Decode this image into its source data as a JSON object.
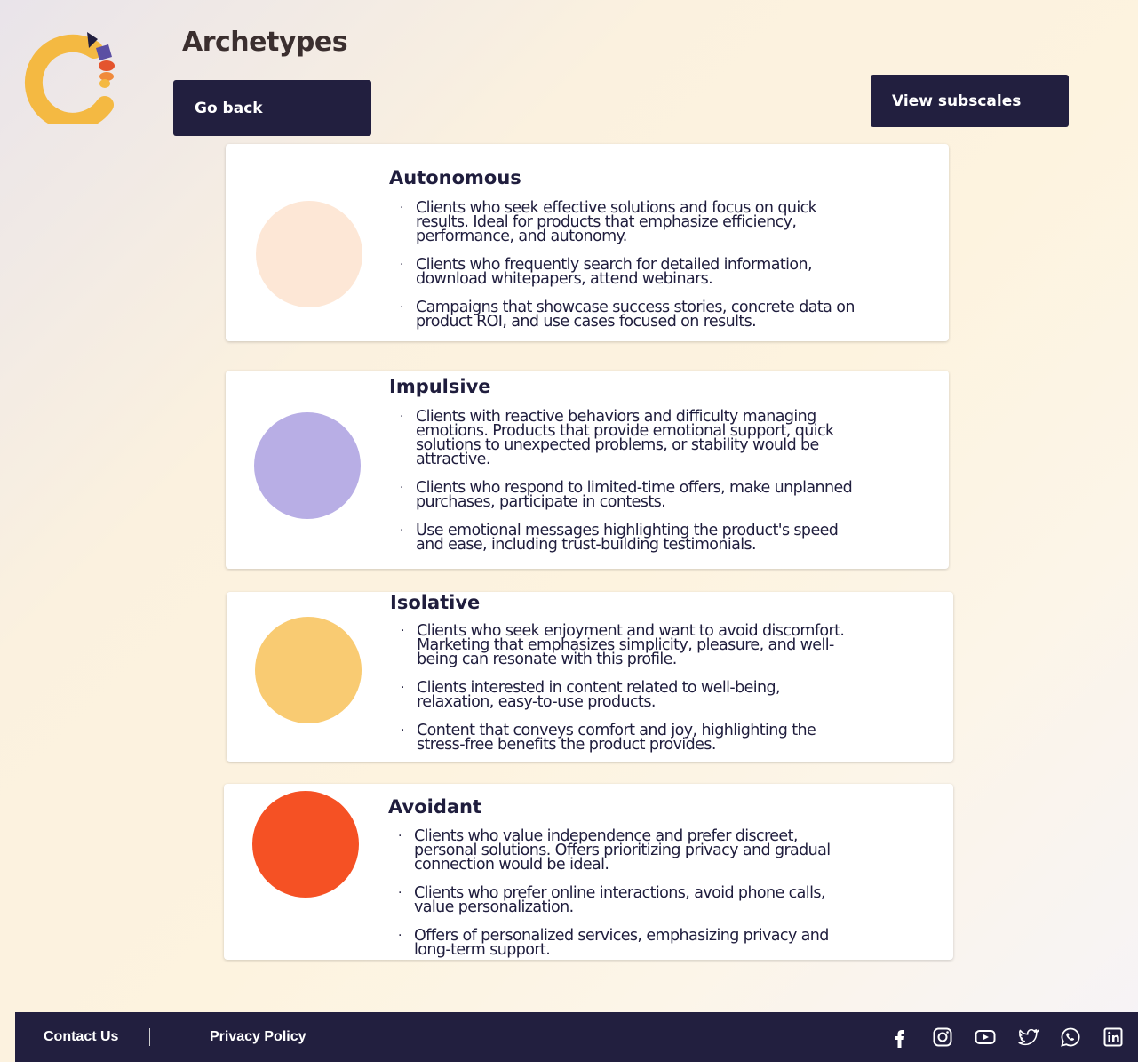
{
  "header": {
    "title": "Archetypes",
    "back_label": "Go back",
    "subscales_label": "View subscales"
  },
  "archetypes": [
    {
      "name": "Autonomous",
      "color": "#fde7d6",
      "points": [
        "Clients who seek effective solutions and focus on quick results. Ideal for products that emphasize efficiency, performance, and autonomy.",
        "Clients who frequently search for detailed information, download whitepapers, attend webinars.",
        "Campaigns that showcase success stories, concrete data on product ROI, and use cases focused on results."
      ]
    },
    {
      "name": "Impulsive",
      "color": "#b8aee5",
      "points": [
        "Clients with reactive behaviors and difficulty managing emotions. Products that provide emotional support, quick solutions to unexpected problems, or stability would be attractive.",
        "Clients who respond to limited-time offers, make unplanned purchases, participate in contests.",
        "Use emotional messages highlighting the product's speed and ease, including trust-building testimonials."
      ]
    },
    {
      "name": "Isolative",
      "color": "#f9cb72",
      "points": [
        "Clients who seek enjoyment and want to avoid discomfort. Marketing that emphasizes simplicity, pleasure, and well-being can resonate with this profile.",
        "Clients interested in content related to well-being, relaxation, easy-to-use products.",
        "Content that conveys comfort and joy, highlighting the stress-free benefits the product provides."
      ]
    },
    {
      "name": "Avoidant",
      "color": "#f55124",
      "points": [
        "Clients who value independence and prefer discreet, personal solutions. Offers prioritizing privacy and gradual connection would be ideal.",
        "Clients who prefer online interactions, avoid phone calls, value personalization.",
        "Offers of personalized services, emphasizing privacy and long-term support."
      ]
    }
  ],
  "footer": {
    "contact_label": "Contact Us",
    "privacy_label": "Privacy Policy",
    "social_icons": [
      "facebook-icon",
      "instagram-icon",
      "youtube-icon",
      "twitter-icon",
      "whatsapp-icon",
      "linkedin-icon"
    ]
  },
  "colors": {
    "button_bg": "#221f3f",
    "footer_bg": "#221f3f",
    "logo_ring": "#f4b942",
    "logo_accent_dark": "#221f3f",
    "logo_accent_purple": "#5b4fa3",
    "logo_accent_red": "#e4542d"
  }
}
